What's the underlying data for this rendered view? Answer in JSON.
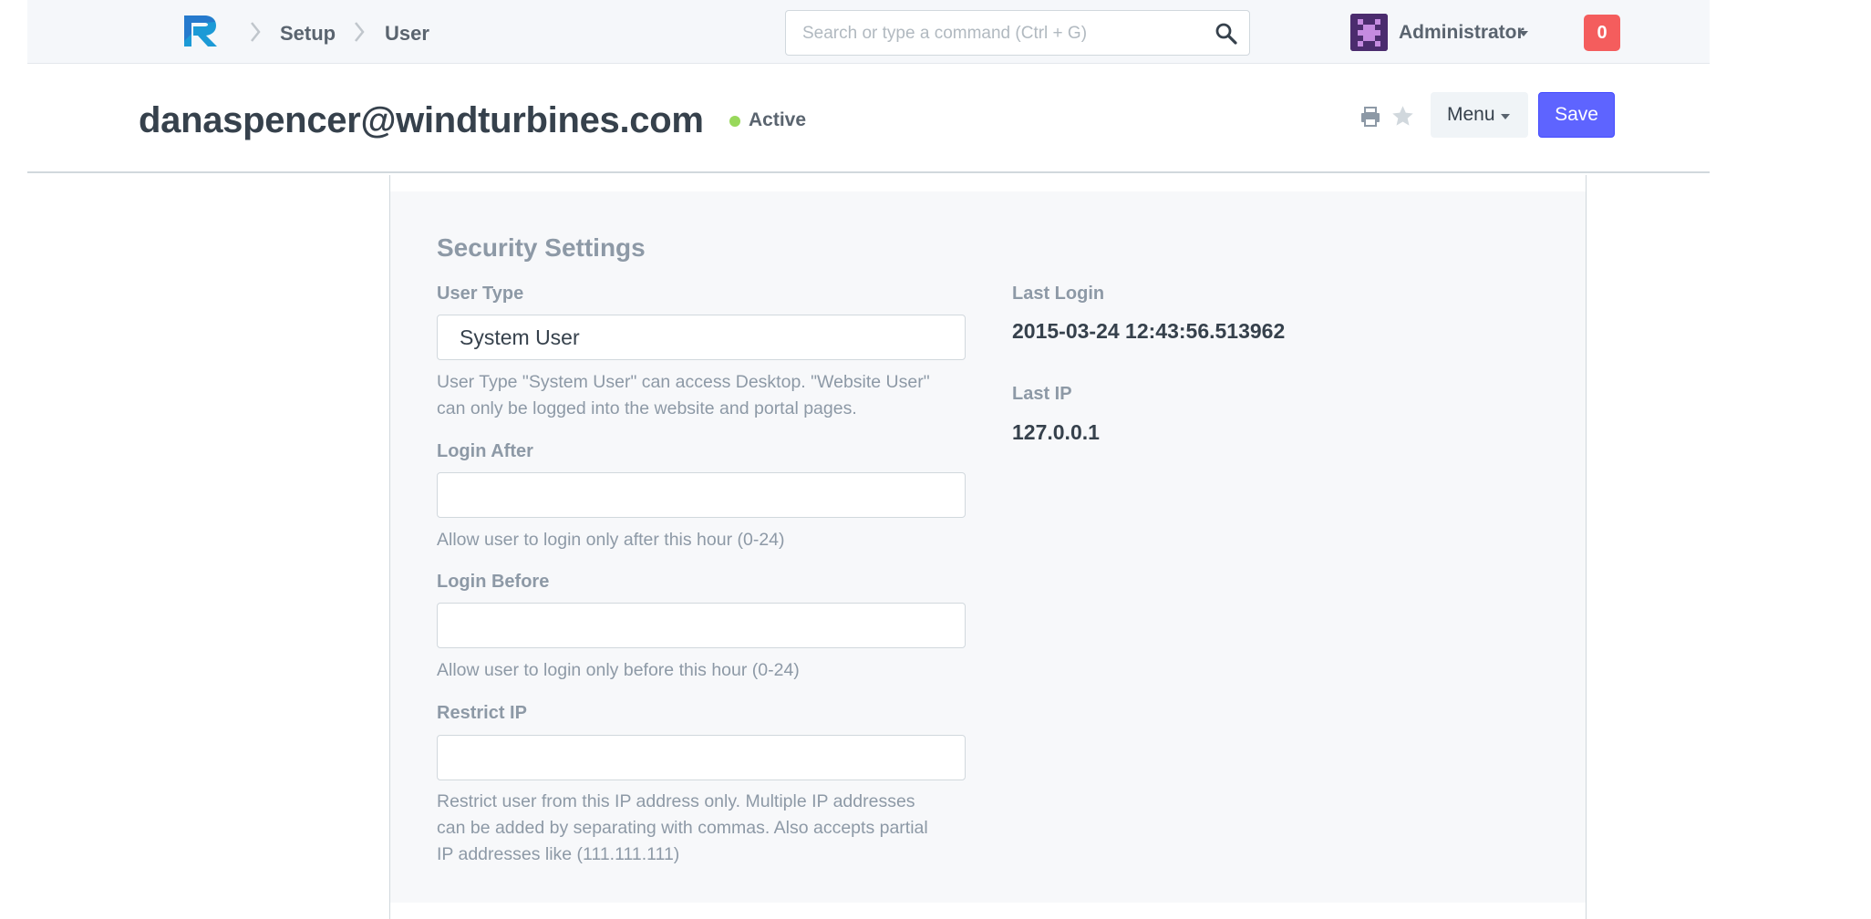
{
  "navbar": {
    "breadcrumbs": [
      "Setup",
      "User"
    ],
    "search_placeholder": "Search or type a command (Ctrl + G)",
    "user_name": "Administrator",
    "notification_count": "0",
    "icons": {
      "logo": "app-logo",
      "separator": "chevron-right-icon",
      "search": "search-icon",
      "dropdown": "caret-down-icon"
    },
    "colors": {
      "notification": "#f45d5d",
      "avatar": "#4b2c6e"
    }
  },
  "page_head": {
    "title": "danaspencer@windturbines.com",
    "status": "Active",
    "status_color": "#98d85b",
    "menu_label": "Menu",
    "save_label": "Save",
    "save_color": "#5e64ff",
    "icons": {
      "print": "print-icon",
      "star": "star-icon"
    }
  },
  "form": {
    "section_title": "Security Settings",
    "user_type": {
      "label": "User Type",
      "value": "System User",
      "help_lines": [
        "User Type \"System User\" can access Desktop. \"Website User\"",
        "can only be logged into the website and portal pages."
      ]
    },
    "login_after": {
      "label": "Login After",
      "value": "",
      "help": "Allow user to login only after this hour (0-24)"
    },
    "login_before": {
      "label": "Login Before",
      "value": "",
      "help": "Allow user to login only before this hour (0-24)"
    },
    "restrict_ip": {
      "label": "Restrict IP",
      "value": "",
      "help_lines": [
        "Restrict user from this IP address only. Multiple IP addresses",
        "can be added by separating with commas. Also accepts partial",
        "IP addresses like (111.111.111)"
      ]
    },
    "last_login": {
      "label": "Last Login",
      "value": "2015-03-24 12:43:56.513962"
    },
    "last_ip": {
      "label": "Last IP",
      "value": "127.0.0.1"
    }
  }
}
